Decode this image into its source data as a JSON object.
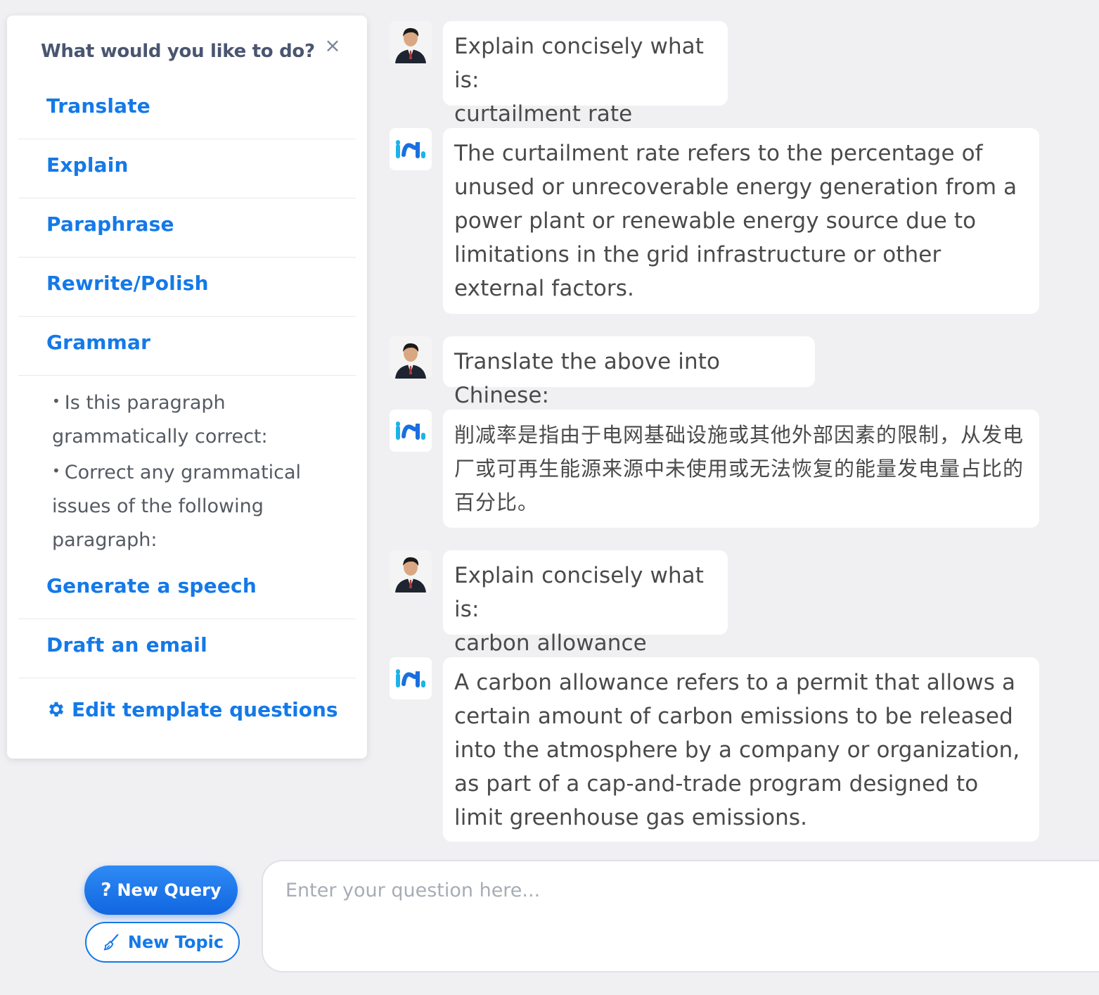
{
  "menu": {
    "title": "What would you like to do?",
    "close_symbol": "×",
    "items": [
      {
        "label": "Translate"
      },
      {
        "label": "Explain"
      },
      {
        "label": "Paraphrase"
      },
      {
        "label": "Rewrite/Polish"
      },
      {
        "label": "Grammar"
      },
      {
        "label": "Generate a speech"
      },
      {
        "label": "Draft an email"
      }
    ],
    "grammar_details": [
      "Is this paragraph grammatically correct:",
      "Correct any grammatical issues of the following paragraph:"
    ],
    "edit_templates_label": "Edit template questions",
    "edit_templates_icon": "gear-icon"
  },
  "chat": {
    "messages": [
      {
        "role": "user",
        "text": "Explain concisely what is:\ncurtailment rate"
      },
      {
        "role": "assistant",
        "text": "The curtailment rate refers to the percentage of unused or unrecoverable energy generation from a power plant or renewable energy source due to limitations in the grid infrastructure or other external factors."
      },
      {
        "role": "user",
        "text": "Translate the above into Chinese:"
      },
      {
        "role": "assistant",
        "text": "削减率是指由于电网基础设施或其他外部因素的限制，从发电厂或可再生能源来源中未使用或无法恢复的能量发电量占比的百分比。"
      },
      {
        "role": "user",
        "text": "Explain concisely what is:\ncarbon allowance"
      },
      {
        "role": "assistant",
        "text": "A carbon allowance refers to a permit that allows a certain amount of carbon emissions to be released into the atmosphere by a company or organization, as part of a cap-and-trade program designed to limit greenhouse gas emissions."
      }
    ]
  },
  "composer": {
    "new_query_label": "New Query",
    "new_query_icon": "question-icon",
    "new_topic_label": "New Topic",
    "new_topic_icon": "broom-icon",
    "placeholder": "Enter your question here..."
  },
  "colors": {
    "accent": "#1479e8",
    "background": "#f0f0f2",
    "bubble": "#ffffff",
    "assistant_logo": "#1bb3e8"
  }
}
